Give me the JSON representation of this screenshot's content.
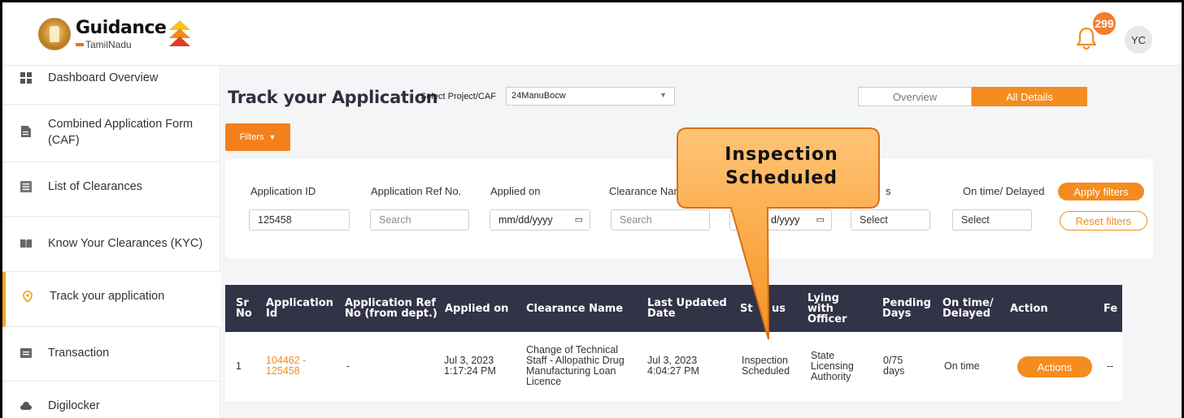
{
  "header": {
    "logo_main": "Guidance",
    "logo_sub": "TamilNadu",
    "notification_count": "299",
    "avatar_initials": "YC"
  },
  "sidebar": {
    "items": [
      {
        "label": "Dashboard Overview",
        "icon": "dashboard-icon"
      },
      {
        "label": "Combined Application Form (CAF)",
        "icon": "document-icon"
      },
      {
        "label": "List of Clearances",
        "icon": "list-icon"
      },
      {
        "label": "Know Your Clearances (KYC)",
        "icon": "book-icon"
      },
      {
        "label": "Track your application",
        "icon": "location-pin-icon"
      },
      {
        "label": "Transaction",
        "icon": "transaction-icon"
      },
      {
        "label": "Digilocker",
        "icon": "cloud-icon"
      }
    ]
  },
  "main": {
    "title": "Track your Application",
    "project_label": "Select Project/CAF",
    "project_value": "24ManuBocw",
    "tabs": [
      {
        "label": "Overview"
      },
      {
        "label": "All Details"
      }
    ],
    "filters_button": "Filters"
  },
  "filters": {
    "application_id_label": "Application ID",
    "application_id_value": "125458",
    "app_ref_label": "Application Ref No.",
    "app_ref_placeholder": "Search",
    "applied_on_label": "Applied on",
    "applied_on_placeholder": "mm/dd/yyyy",
    "clearance_name_label": "Clearance Nam",
    "clearance_name_placeholder": "Search",
    "date_partial": "d/yyyy",
    "status_label_partial": "s",
    "status_placeholder": "Select",
    "ontime_label": "On time/ Delayed",
    "ontime_placeholder": "Select",
    "apply_label": "Apply filters",
    "reset_label": "Reset filters"
  },
  "table": {
    "headers": {
      "sr": "Sr No",
      "app_id": "Application Id",
      "app_ref": "Application Ref No (from dept.)",
      "applied_on": "Applied on",
      "clearance": "Clearance Name",
      "last_updated": "Last Updated Date",
      "status_a": "St",
      "status_b": "us",
      "lying": "Lying with Officer",
      "pending": "Pending Days",
      "ontime": "On time/ Delayed",
      "action": "Action",
      "fee": "Fe"
    },
    "row": {
      "sr": "1",
      "app_id": "104462 - 125458",
      "app_ref": "-",
      "applied_on": "Jul 3, 2023 1:17:24 PM",
      "clearance": "Change of Technical Staff - Allopathic Drug Manufacturing Loan Licence",
      "last_updated": "Jul 3, 2023 4:04:27 PM",
      "status": "Inspection Scheduled",
      "lying": "State Licensing Authority",
      "pending": "0/75 days",
      "ontime": "On time",
      "action": "Actions",
      "fee": "--"
    }
  },
  "callout": {
    "line1": "Inspection",
    "line2": "Scheduled"
  }
}
